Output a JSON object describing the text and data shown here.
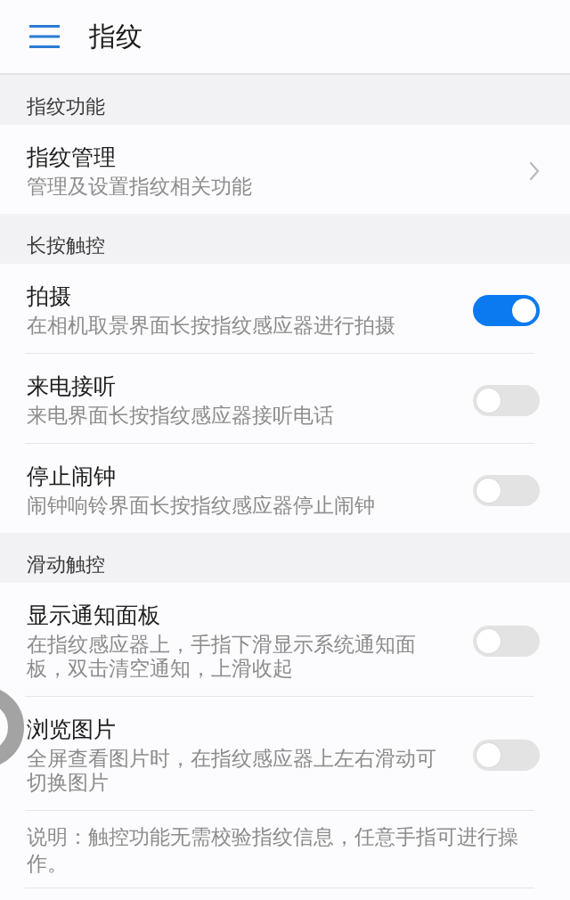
{
  "app_bar": {
    "title": "指纹"
  },
  "sections": [
    {
      "header": "指纹功能",
      "items": [
        {
          "kind": "link",
          "title": "指纹管理",
          "subtitle": "管理及设置指纹相关功能"
        }
      ]
    },
    {
      "header": "长按触控",
      "items": [
        {
          "kind": "switch",
          "title": "拍摄",
          "subtitle": "在相机取景界面长按指纹感应器进行拍摄",
          "on": true
        },
        {
          "kind": "switch",
          "title": "来电接听",
          "subtitle": "来电界面长按指纹感应器接听电话",
          "on": false
        },
        {
          "kind": "switch",
          "title": "停止闹钟",
          "subtitle": "闹钟响铃界面长按指纹感应器停止闹钟",
          "on": false
        }
      ]
    },
    {
      "header": "滑动触控",
      "items": [
        {
          "kind": "switch",
          "title": "显示通知面板",
          "subtitle": "在指纹感应器上，手指下滑显示系统通知面板，双击清空通知，上滑收起",
          "on": false
        },
        {
          "kind": "switch",
          "title": "浏览图片",
          "subtitle": "全屏查看图片时，在指纹感应器上左右滑动可切换图片",
          "on": false
        }
      ],
      "note": "说明：触控功能无需校验指纹信息，任意手指可进行操作。"
    }
  ]
}
